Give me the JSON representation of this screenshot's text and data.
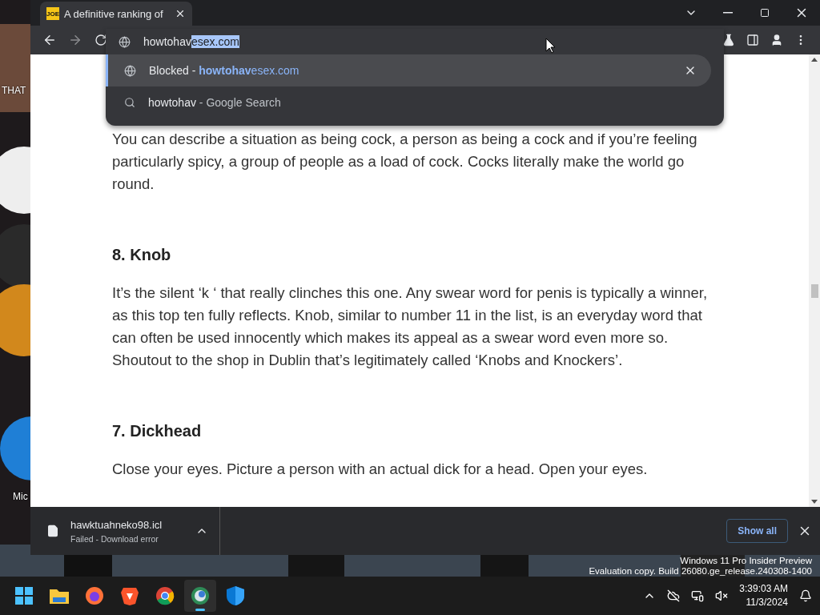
{
  "desktop_icons": [
    {
      "label": "THAT"
    },
    {
      "label": "Mic"
    }
  ],
  "browser": {
    "tab": {
      "favicon": "JOE",
      "title": "A definitive ranking of",
      "selected": true
    },
    "omnibox": {
      "typed": "howtohav",
      "selected_text": "esex.com",
      "suggestions": [
        {
          "kind": "site",
          "prefix": "Blocked - ",
          "match": "howtohav",
          "rest": "esex.com",
          "selected": true
        },
        {
          "kind": "search",
          "match": "howtohav",
          "rest": " - Google Search",
          "selected": false
        }
      ]
    },
    "article": [
      {
        "kind": "paragraph",
        "text": "You can describe a situation as being cock, a person as being a cock and if you’re feeling particularly spicy, a group of people as a load of cock. Cocks literally make the world go round."
      },
      {
        "kind": "heading",
        "text": "8. Knob"
      },
      {
        "kind": "paragraph",
        "text": "It’s the silent ‘k ‘ that really clinches this one. Any swear word for penis is typically a winner, as this top ten fully reflects. Knob, similar to number 11 in the list, is an everyday word that can often be used innocently which makes its appeal as a swear word even more so. Shoutout to the shop in Dublin that’s legitimately called ‘Knobs and Knockers’."
      },
      {
        "kind": "heading",
        "text": "7. Dickhead"
      },
      {
        "kind": "paragraph",
        "text": "Close your eyes. Picture a person with an actual dick for a head. Open your eyes."
      }
    ],
    "download": {
      "file": "hawktuahneko98.icl",
      "status": "Failed - Download error",
      "show_all": "Show all"
    }
  },
  "watermark": [
    "Windows 11 Pro Insider Preview",
    "Evaluation copy. Build 26080.ge_release.240308-1400"
  ],
  "taskbar": {
    "apps": [
      {
        "kind": "start",
        "selected": false
      },
      {
        "kind": "folder",
        "selected": false
      },
      {
        "kind": "firefox",
        "selected": false
      },
      {
        "kind": "brave",
        "selected": false
      },
      {
        "kind": "chrome",
        "selected": false
      },
      {
        "kind": "edge",
        "selected": true
      },
      {
        "kind": "shield",
        "selected": false
      }
    ],
    "time": "3:39:03 AM",
    "date": "11/3/2024"
  }
}
